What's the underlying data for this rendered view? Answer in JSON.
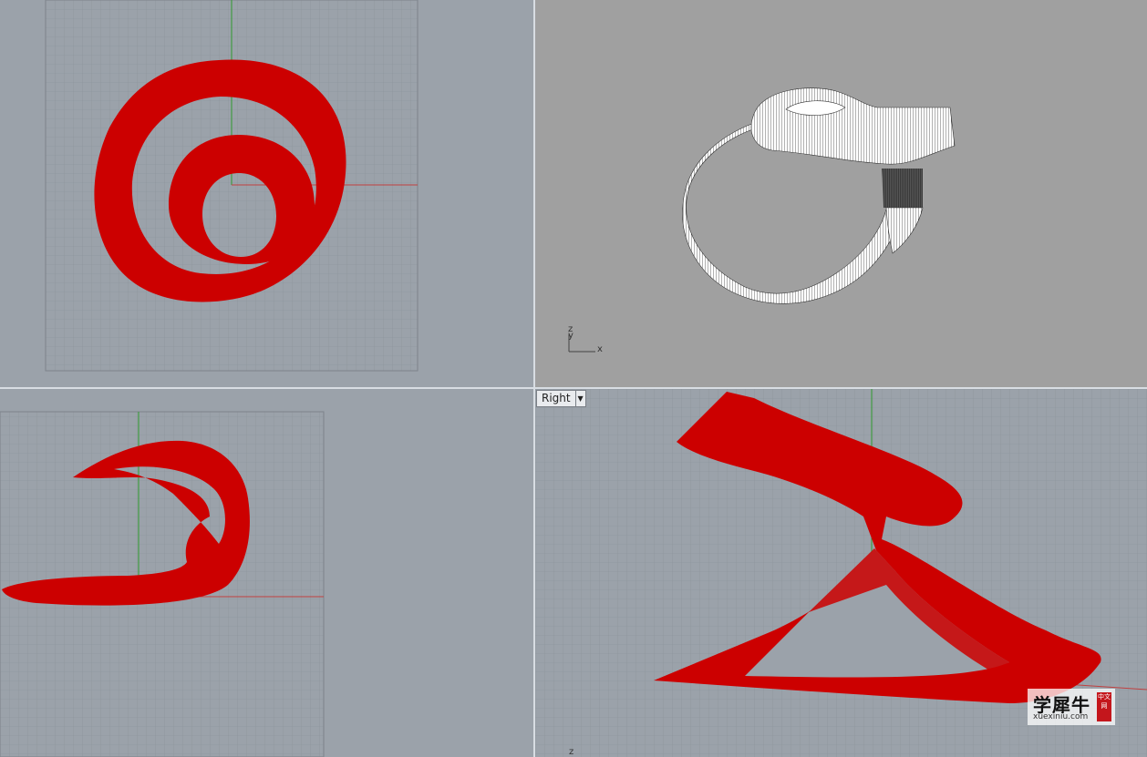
{
  "viewports": {
    "top": {
      "name": "",
      "shape_color": "#cc0000"
    },
    "perspective": {
      "name": "",
      "shape_color": "#ffffff",
      "axis_z": "z",
      "axis_y": "y",
      "axis_x": "x"
    },
    "front": {
      "name": "",
      "shape_color": "#cc0000"
    },
    "right": {
      "name": "Right",
      "dropdown_icon": "chevron-down-icon",
      "shape_color": "#cc0000",
      "axis_z": "z"
    }
  },
  "colors": {
    "grid_line": "#8a9098",
    "grid_bg": "#9ba2aa",
    "x_axis": "#c04040",
    "y_axis": "#2f9a2f",
    "shape_red": "#cc0000",
    "persp_bg": "#a0a0a0"
  },
  "watermark": {
    "title": "学犀牛",
    "url": "xuexiniu.com",
    "seal": "中文网"
  }
}
